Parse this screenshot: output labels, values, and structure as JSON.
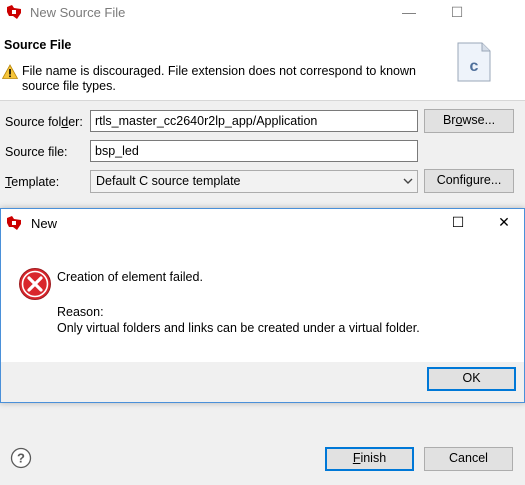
{
  "outer": {
    "title": "New Source File",
    "page_title": "Source File",
    "warning": "File name is discouraged. File extension does not correspond to known source file types.",
    "file_art_letter": "c",
    "source_folder": {
      "label_pre": "Source fol",
      "label_mnemonic": "d",
      "label_post": "er:",
      "value": "rtls_master_cc2640r2lp_app/Application",
      "browse_pre": "Br",
      "browse_mnemonic": "o",
      "browse_post": "wse..."
    },
    "source_file": {
      "label": "Source file:",
      "value": "bsp_led"
    },
    "template": {
      "label_mnemonic": "T",
      "label_post": "emplate:",
      "value": "Default C source template",
      "configure_label": "Configure..."
    },
    "finish_mnemonic": "F",
    "finish_post": "inish",
    "cancel_label": "Cancel"
  },
  "modal": {
    "title": "New",
    "message": "Creation of element failed.",
    "reason_label": "Reason:",
    "reason_text": "Only virtual folders and links can be created under a virtual folder.",
    "ok_label": "OK"
  },
  "window_controls": {
    "minimize": "—",
    "maximize": "☐",
    "close": "✕"
  },
  "icons": {
    "app": "ti-ccs-icon",
    "warning": "warning-icon",
    "error": "error-icon",
    "help": "help-icon",
    "dropdown": "chevron-down-icon"
  },
  "colors": {
    "accent": "#0078d7",
    "app_red": "#cc0000",
    "error_red": "#d9262c",
    "warning_yellow": "#f6c53a"
  }
}
